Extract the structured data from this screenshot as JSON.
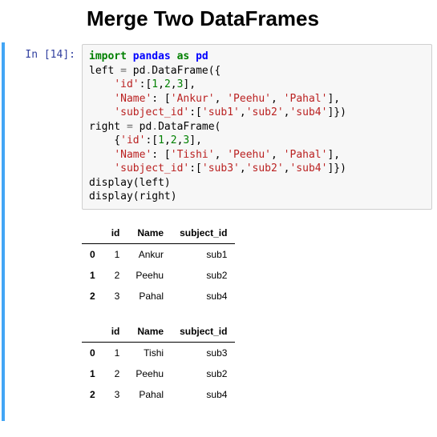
{
  "title": "Merge Two DataFrames",
  "cell": {
    "prompt": "In [14]:",
    "code_tokens": [
      {
        "t": "import",
        "c": "kw"
      },
      {
        "t": " "
      },
      {
        "t": "pandas",
        "c": "nn"
      },
      {
        "t": " "
      },
      {
        "t": "as",
        "c": "kw"
      },
      {
        "t": " "
      },
      {
        "t": "pd",
        "c": "nn"
      },
      {
        "t": "\n"
      },
      {
        "t": "left "
      },
      {
        "t": "=",
        "c": "op"
      },
      {
        "t": " pd"
      },
      {
        "t": ".",
        "c": "op"
      },
      {
        "t": "DataFrame({"
      },
      {
        "t": "\n"
      },
      {
        "t": "    "
      },
      {
        "t": "'id'",
        "c": "str"
      },
      {
        "t": ":["
      },
      {
        "t": "1",
        "c": "num"
      },
      {
        "t": ","
      },
      {
        "t": "2",
        "c": "num"
      },
      {
        "t": ","
      },
      {
        "t": "3",
        "c": "num"
      },
      {
        "t": "],"
      },
      {
        "t": "\n"
      },
      {
        "t": "    "
      },
      {
        "t": "'Name'",
        "c": "str"
      },
      {
        "t": ": ["
      },
      {
        "t": "'Ankur'",
        "c": "str"
      },
      {
        "t": ", "
      },
      {
        "t": "'Peehu'",
        "c": "str"
      },
      {
        "t": ", "
      },
      {
        "t": "'Pahal'",
        "c": "str"
      },
      {
        "t": "],"
      },
      {
        "t": "\n"
      },
      {
        "t": "    "
      },
      {
        "t": "'subject_id'",
        "c": "str"
      },
      {
        "t": ":["
      },
      {
        "t": "'sub1'",
        "c": "str"
      },
      {
        "t": ","
      },
      {
        "t": "'sub2'",
        "c": "str"
      },
      {
        "t": ","
      },
      {
        "t": "'sub4'",
        "c": "str"
      },
      {
        "t": "]})"
      },
      {
        "t": "\n"
      },
      {
        "t": "right "
      },
      {
        "t": "=",
        "c": "op"
      },
      {
        "t": " pd"
      },
      {
        "t": ".",
        "c": "op"
      },
      {
        "t": "DataFrame("
      },
      {
        "t": "\n"
      },
      {
        "t": "    {"
      },
      {
        "t": "'id'",
        "c": "str"
      },
      {
        "t": ":["
      },
      {
        "t": "1",
        "c": "num"
      },
      {
        "t": ","
      },
      {
        "t": "2",
        "c": "num"
      },
      {
        "t": ","
      },
      {
        "t": "3",
        "c": "num"
      },
      {
        "t": "],"
      },
      {
        "t": "\n"
      },
      {
        "t": "    "
      },
      {
        "t": "'Name'",
        "c": "str"
      },
      {
        "t": ": ["
      },
      {
        "t": "'Tishi'",
        "c": "str"
      },
      {
        "t": ", "
      },
      {
        "t": "'Peehu'",
        "c": "str"
      },
      {
        "t": ", "
      },
      {
        "t": "'Pahal'",
        "c": "str"
      },
      {
        "t": "],"
      },
      {
        "t": "\n"
      },
      {
        "t": "    "
      },
      {
        "t": "'subject_id'",
        "c": "str"
      },
      {
        "t": ":["
      },
      {
        "t": "'sub3'",
        "c": "str"
      },
      {
        "t": ","
      },
      {
        "t": "'sub2'",
        "c": "str"
      },
      {
        "t": ","
      },
      {
        "t": "'sub4'",
        "c": "str"
      },
      {
        "t": "]})"
      },
      {
        "t": "\n"
      },
      {
        "t": "display(left)"
      },
      {
        "t": "\n"
      },
      {
        "t": "display(right)"
      }
    ]
  },
  "tables": [
    {
      "columns": [
        "id",
        "Name",
        "subject_id"
      ],
      "index": [
        "0",
        "1",
        "2"
      ],
      "rows": [
        [
          "1",
          "Ankur",
          "sub1"
        ],
        [
          "2",
          "Peehu",
          "sub2"
        ],
        [
          "3",
          "Pahal",
          "sub4"
        ]
      ]
    },
    {
      "columns": [
        "id",
        "Name",
        "subject_id"
      ],
      "index": [
        "0",
        "1",
        "2"
      ],
      "rows": [
        [
          "1",
          "Tishi",
          "sub3"
        ],
        [
          "2",
          "Peehu",
          "sub2"
        ],
        [
          "3",
          "Pahal",
          "sub4"
        ]
      ]
    }
  ]
}
